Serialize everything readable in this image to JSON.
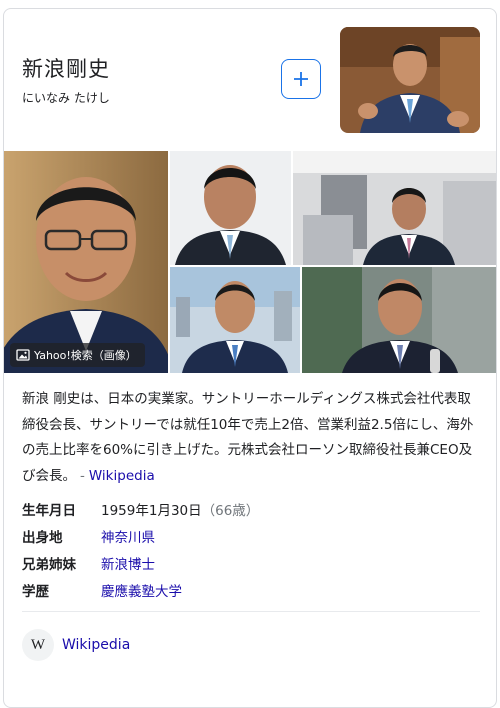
{
  "header": {
    "name": "新浪剛史",
    "reading": "にいなみ たけし",
    "add_icon": "plus-icon"
  },
  "images": {
    "badge_label": "Yahoo!検索（画像）",
    "badge_icon": "image-icon"
  },
  "description": {
    "text": "新浪 剛史は、日本の実業家。サントリーホールディングス株式会社代表取締役会長、サントリーでは就任10年で売上2倍、営業利益2.5倍にし、海外の売上比率を60%に引き上げた。元株式会社ローソン取締役社長兼CEO及び会長。",
    "dash": "-",
    "source": "Wikipedia"
  },
  "facts": [
    {
      "key": "生年月日",
      "value": "1959年1月30日",
      "extra": "（66歳）",
      "link": false
    },
    {
      "key": "出身地",
      "value": "神奈川県",
      "extra": "",
      "link": true
    },
    {
      "key": "兄弟姉妹",
      "value": "新浪博士",
      "extra": "",
      "link": true
    },
    {
      "key": "学歴",
      "value": "慶應義塾大学",
      "extra": "",
      "link": true
    }
  ],
  "source_link": {
    "icon_letter": "W",
    "label": "Wikipedia"
  },
  "colors": {
    "link": "#1a0dab",
    "accent": "#1a73e8",
    "border": "#dadce0"
  }
}
